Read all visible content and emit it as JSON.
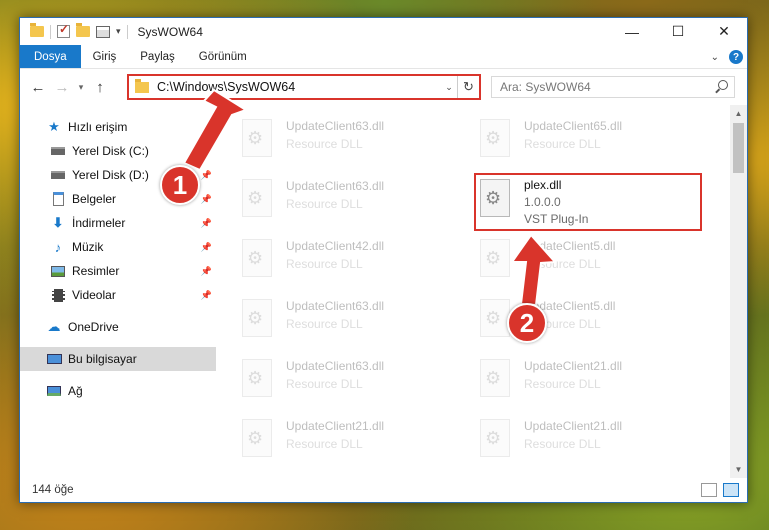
{
  "window": {
    "title": "SysWOW64",
    "controls": {
      "minimize": "—",
      "maximize": "☐",
      "close": "✕"
    }
  },
  "ribbon": {
    "tabs": [
      {
        "label": "Dosya",
        "active": true
      },
      {
        "label": "Giriş"
      },
      {
        "label": "Paylaş"
      },
      {
        "label": "Görünüm"
      }
    ],
    "help_label": "?"
  },
  "address": {
    "path": "C:\\Windows\\SysWOW64",
    "search_placeholder": "Ara: SysWOW64"
  },
  "sidebar": {
    "items": [
      {
        "label": "Hızlı erişim",
        "icon": "star-icon"
      },
      {
        "label": "Yerel Disk (C:)",
        "icon": "drive-icon",
        "pinned": true
      },
      {
        "label": "Yerel Disk (D:)",
        "icon": "drive-icon",
        "pinned": true
      },
      {
        "label": "Belgeler",
        "icon": "documents-icon",
        "pinned": true
      },
      {
        "label": "İndirmeler",
        "icon": "download-icon",
        "pinned": true
      },
      {
        "label": "Müzik",
        "icon": "music-icon",
        "pinned": true
      },
      {
        "label": "Resimler",
        "icon": "pictures-icon",
        "pinned": true
      },
      {
        "label": "Videolar",
        "icon": "videos-icon",
        "pinned": true
      },
      {
        "label": "OneDrive",
        "icon": "cloud-icon"
      },
      {
        "label": "Bu bilgisayar",
        "icon": "computer-icon",
        "selected": true
      },
      {
        "label": "Ağ",
        "icon": "network-icon"
      }
    ]
  },
  "files": [
    {
      "name": "UpdateClient63.dll",
      "type": "Resource DLL",
      "faded": true
    },
    {
      "name": "UpdateClient65.dll",
      "type": "Resource DLL",
      "faded": true
    },
    {
      "name": "UpdateClient63.dll",
      "type": "Resource DLL",
      "faded": true
    },
    {
      "name": "plex.dll",
      "version": "1.0.0.0",
      "type": "VST Plug-In",
      "faded": false,
      "highlighted": true
    },
    {
      "name": "UpdateClient42.dll",
      "type": "Resource DLL",
      "faded": true
    },
    {
      "name": "UpdateClient5.dll",
      "type": "Resource DLL",
      "faded": true
    },
    {
      "name": "UpdateClient63.dll",
      "type": "Resource DLL",
      "faded": true
    },
    {
      "name": "UpdateClient5.dll",
      "type": "Resource DLL",
      "faded": true
    },
    {
      "name": "UpdateClient63.dll",
      "type": "Resource DLL",
      "faded": true
    },
    {
      "name": "UpdateClient21.dll",
      "type": "Resource DLL",
      "faded": true
    },
    {
      "name": "UpdateClient21.dll",
      "type": "Resource DLL",
      "faded": true
    },
    {
      "name": "UpdateClient21.dll",
      "type": "Resource DLL",
      "faded": true
    }
  ],
  "status": {
    "item_count": "144 öğe"
  },
  "annotations": {
    "step1": "1",
    "step2": "2",
    "color": "#d9342b"
  }
}
